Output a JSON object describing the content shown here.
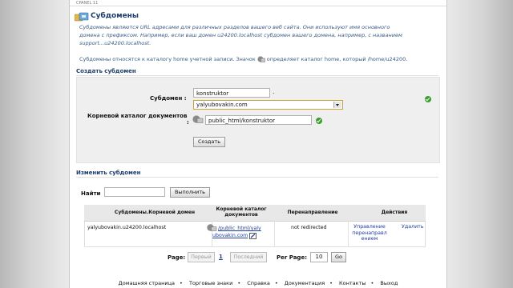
{
  "header": {
    "top_caption": "CPANEL 11",
    "title": "Субдомены"
  },
  "description": {
    "line1": "Субдомены являются URL адресами для различных разделов вашего веб сайта. Они используют имя основного",
    "line2": "домена с префиксом. Например, если ваш домен u24200.localhost субдомен вашего домена, например, с названием",
    "line3": "support...u24200.localhost.",
    "home_line_start": "Субдомены относятся к каталогу home учетной записи. Значок",
    "home_line_end": "определяет каталог home, который /home/u24200."
  },
  "create_section": {
    "title": "Создать субдомен",
    "subdomain_label": "Субдомен :",
    "subdomain_value": "konstruktor",
    "dot": ".",
    "domain_selected": "yalyubovakin.com",
    "docroot_label": "Корневой каталог документов",
    "docroot_colon": ":",
    "docroot_value": "public_html/konstruktor",
    "create_button": "Создать"
  },
  "modify_section": {
    "title": "Изменить субдомен",
    "search_label": "Найти",
    "search_value": "",
    "search_button": "Выполнить"
  },
  "table": {
    "headers": {
      "subdomain": "Субдомены.Корневой домен",
      "docroot": "Корневой каталог документов",
      "redirect": "Перенаправление",
      "actions": "Действия"
    },
    "rows": [
      {
        "subdomain": "yalyubovakin.u24200.localhost",
        "docroot_line1": "/public_html/yaly",
        "docroot_line2": "ubovakin.com",
        "redirect": "not redirected",
        "manage_redirect": "Управление перенаправл ением",
        "delete": "Удалить"
      }
    ]
  },
  "pager": {
    "page_label": "Page:",
    "first": "Первый",
    "current": "1",
    "last": "Последний",
    "per_page_label": "Per Page:",
    "per_page_value": "10",
    "go_button": "Go"
  },
  "footer": {
    "links": [
      "Домашняя страница",
      "Торговые знаки",
      "Справка",
      "Документация",
      "Контакты",
      "Выход"
    ]
  },
  "colors": {
    "title": "#1b3d6d",
    "description": "#3a5a86",
    "ok_check": "#3a9b2e",
    "select_border": "#c7a236"
  },
  "icons": {
    "page": "subdomains-icon",
    "home": "home-folder-icon",
    "ok": "check-circle-icon",
    "edit": "edit-icon"
  }
}
